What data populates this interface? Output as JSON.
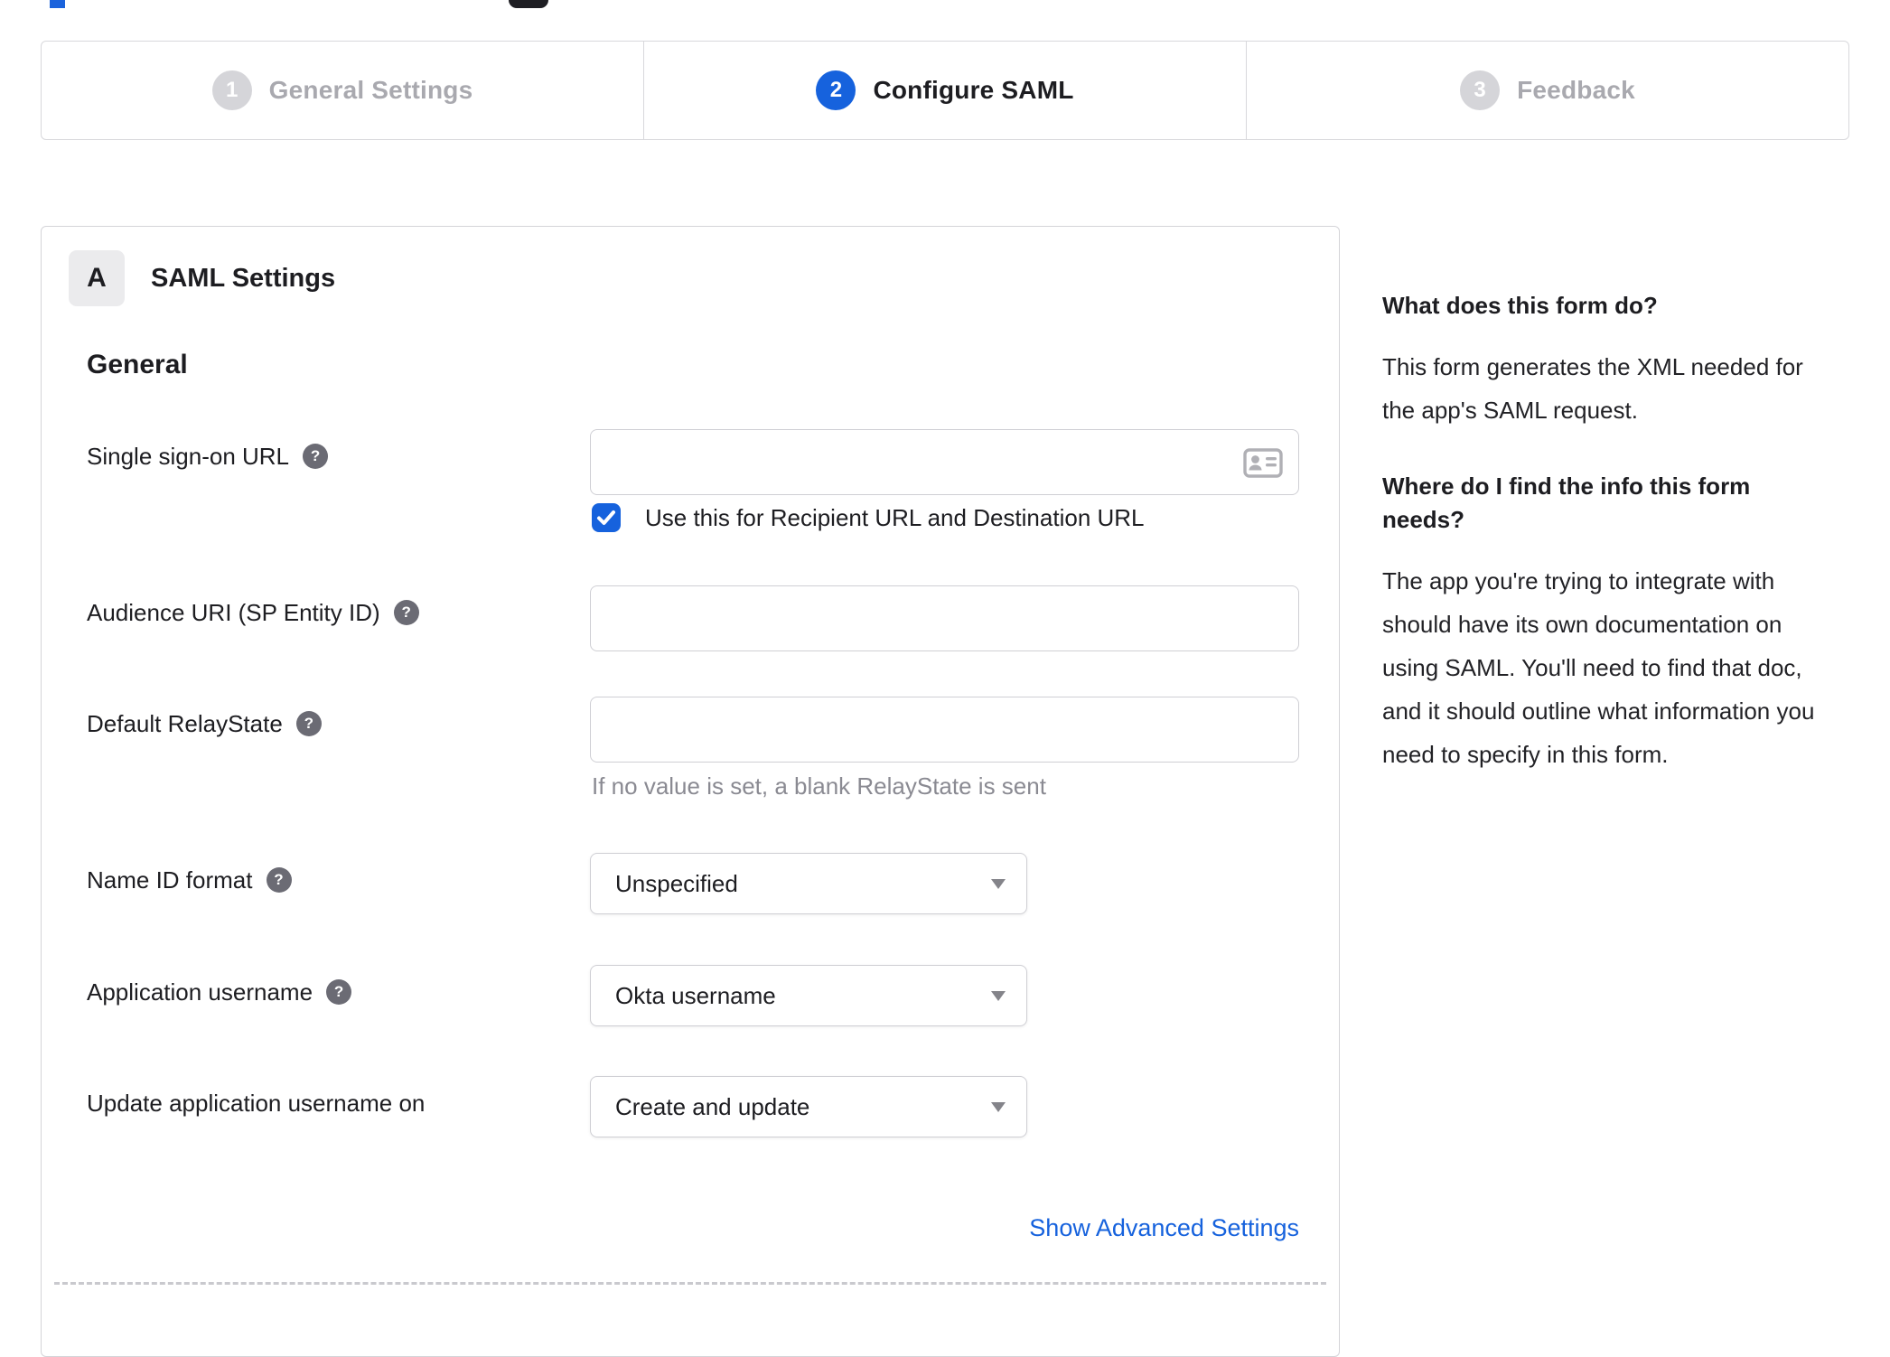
{
  "stepper": {
    "steps": [
      {
        "number": "1",
        "label": "General Settings",
        "active": false
      },
      {
        "number": "2",
        "label": "Configure SAML",
        "active": true
      },
      {
        "number": "3",
        "label": "Feedback",
        "active": false
      }
    ]
  },
  "form": {
    "section_badge": "A",
    "section_title": "SAML Settings",
    "group_heading": "General",
    "help_glyph": "?",
    "fields": {
      "sso_url": {
        "label": "Single sign-on URL",
        "value": "",
        "checkbox_checked": true,
        "checkbox_label": "Use this for Recipient URL and Destination URL"
      },
      "audience_uri": {
        "label": "Audience URI (SP Entity ID)",
        "value": ""
      },
      "relay_state": {
        "label": "Default RelayState",
        "value": "",
        "hint": "If no value is set, a blank RelayState is sent"
      },
      "name_id_format": {
        "label": "Name ID format",
        "value": "Unspecified"
      },
      "app_username": {
        "label": "Application username",
        "value": "Okta username"
      },
      "update_username_on": {
        "label": "Update application username on",
        "value": "Create and update"
      }
    },
    "advanced_link": "Show Advanced Settings"
  },
  "sidebar": {
    "sections": [
      {
        "heading": "What does this form do?",
        "body": "This form generates the XML needed for the app's SAML request."
      },
      {
        "heading": "Where do I find the info this form needs?",
        "body": "The app you're trying to integrate with should have its own documentation on using SAML. You'll need to find that doc, and it should outline what information you need to specify in this form."
      }
    ]
  },
  "colors": {
    "accent_blue": "#1662dd",
    "inactive_gray": "#a9a9af",
    "text_dark": "#1d1d21",
    "border_gray": "#d4d4d8",
    "hint_gray": "#8a8a92",
    "help_icon_gray": "#6b6b74"
  }
}
